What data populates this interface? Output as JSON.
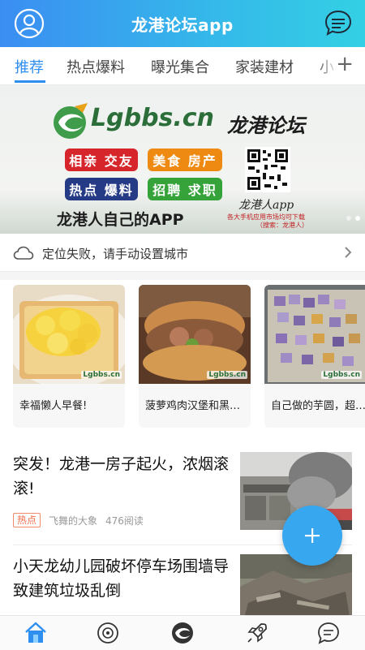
{
  "header": {
    "title": "龙港论坛app",
    "left_icon": "user-avatar-icon",
    "right_icon": "message-bubble-icon",
    "gradient_start": "#3b8df2",
    "gradient_end": "#33d0e4"
  },
  "tabs": {
    "items": [
      {
        "label": "推荐",
        "active": true
      },
      {
        "label": "热点爆料",
        "active": false
      },
      {
        "label": "曝光集合",
        "active": false
      },
      {
        "label": "家装建材",
        "active": false
      },
      {
        "label": "小",
        "active": false
      }
    ],
    "add_label": "+",
    "accent": "#2f8ff0"
  },
  "banner": {
    "site": "Lgbbs.cn",
    "forum_name": "龙港论坛",
    "pills": [
      "相亲 交友",
      "美食 房产",
      "热点 爆料",
      "招聘 求职"
    ],
    "app_label": "龙港人app",
    "download_note": "各大手机应用市场均可下载",
    "search_note": "（搜索：龙港人）",
    "slogan": "龙港人自己的APP",
    "slide_count": 2,
    "active_slide": 1
  },
  "location": {
    "text": "定位失败，请手动设置城市",
    "icon": "cloud-icon"
  },
  "cards": [
    {
      "caption": "幸福懒人早餐!",
      "watermark": "Lgbbs.cn"
    },
    {
      "caption": "菠萝鸡肉汉堡和黑…",
      "watermark": "Lgbbs.cn"
    },
    {
      "caption": "自己做的芋圆，超…",
      "watermark": "Lgbbs.cn"
    }
  ],
  "news": [
    {
      "headline": "突发！龙港一房子起火，浓烟滚滚!",
      "badge": "热点",
      "author": "飞舞的大象",
      "reads": "476阅读"
    },
    {
      "headline": "小天龙幼儿园破坏停车场围墙导致建筑垃圾乱倒"
    }
  ],
  "fab": {
    "label": "+",
    "color": "#37a7ef"
  },
  "bottom_nav": [
    {
      "icon": "home-icon",
      "active": true
    },
    {
      "icon": "discover-icon",
      "active": false
    },
    {
      "icon": "app-logo-icon",
      "active": false
    },
    {
      "icon": "rocket-icon",
      "active": false
    },
    {
      "icon": "chat-icon",
      "active": false
    }
  ]
}
